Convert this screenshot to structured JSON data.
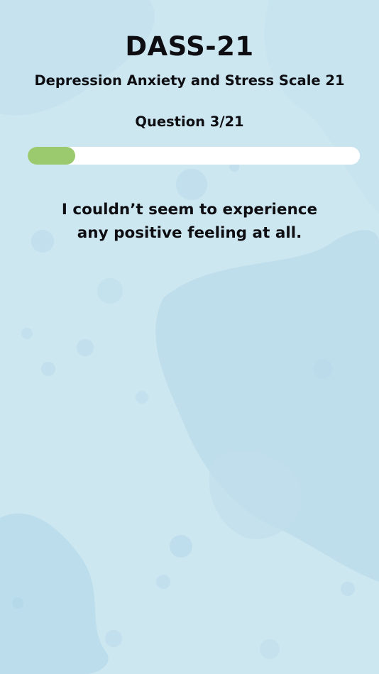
{
  "header": {
    "title": "DASS-21",
    "subtitle": "Depression Anxiety and Stress Scale 21"
  },
  "progress": {
    "label": "Question 3/21",
    "current": 3,
    "total": 21,
    "fill_color": "#9bc96d",
    "track_color": "#ffffff"
  },
  "question": {
    "line1": "I couldn’t seem to experience",
    "line2": "any positive feeling at all."
  },
  "theme": {
    "background": "#cde7f1",
    "text": "#0d0d12"
  }
}
